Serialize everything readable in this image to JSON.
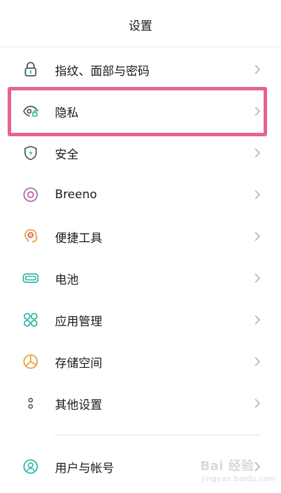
{
  "header": {
    "title": "设置"
  },
  "items": [
    {
      "id": "fingerprint",
      "label": "指纹、面部与密码",
      "icon": "lock-icon"
    },
    {
      "id": "privacy",
      "label": "隐私",
      "icon": "privacy-eye-icon"
    },
    {
      "id": "security",
      "label": "安全",
      "icon": "shield-lightning-icon"
    },
    {
      "id": "breeno",
      "label": "Breeno",
      "icon": "breeno-circle-icon"
    },
    {
      "id": "tools",
      "label": "便捷工具",
      "icon": "convenience-tools-icon"
    },
    {
      "id": "battery",
      "label": "电池",
      "icon": "battery-icon"
    },
    {
      "id": "apps",
      "label": "应用管理",
      "icon": "app-grid-icon"
    },
    {
      "id": "storage",
      "label": "存储空间",
      "icon": "storage-pie-icon"
    },
    {
      "id": "other",
      "label": "其他设置",
      "icon": "more-dots-icon"
    },
    {
      "id": "users",
      "label": "用户与帐号",
      "icon": "user-icon"
    }
  ],
  "watermark": {
    "main": "Bai 经验",
    "sub": "jingyan.baidu.com"
  },
  "colors": {
    "icon_gray": "#4a5560",
    "icon_teal": "#2eb6a6",
    "icon_purple": "#9b6fb8",
    "icon_orange": "#e8a23a",
    "highlight": "#e8628f",
    "chevron": "#b5b5b5"
  }
}
